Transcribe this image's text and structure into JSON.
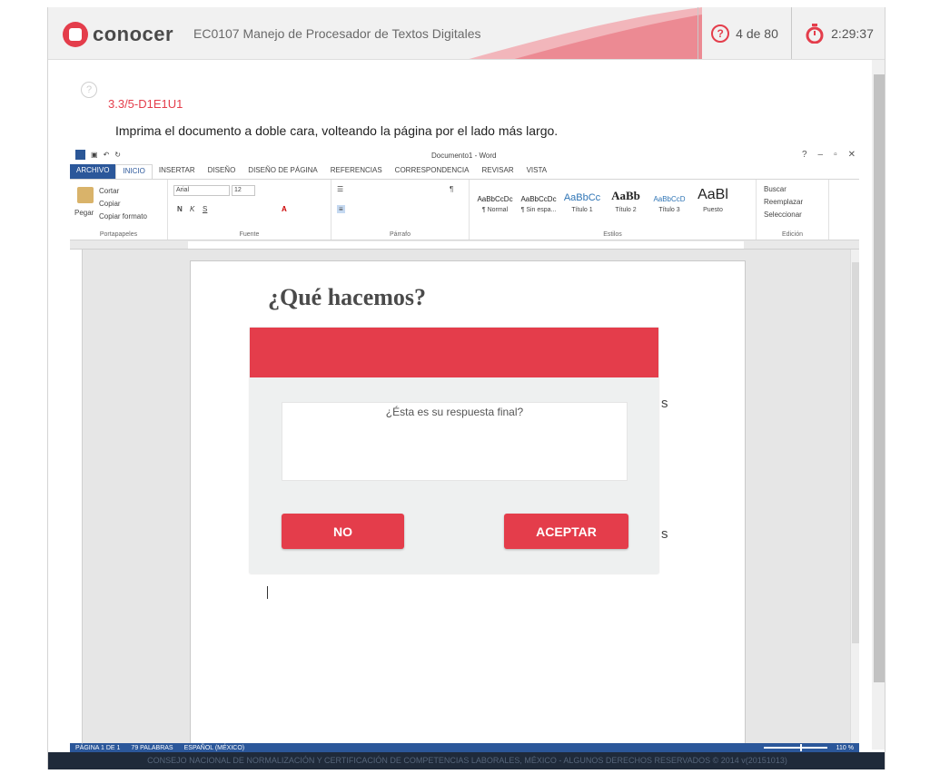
{
  "header": {
    "logo_text": "conocer",
    "exam_title": "EC0107 Manejo de Procesador de Textos Digitales",
    "counter": "4 de 80",
    "timer": "2:29:37"
  },
  "question": {
    "code": "3.3/5-D1E1U1",
    "text": "Imprima el documento a doble cara, volteando la página por el lado más largo."
  },
  "word": {
    "window_title": "Documento1 - Word",
    "tabs": [
      "ARCHIVO",
      "INICIO",
      "INSERTAR",
      "DISEÑO",
      "DISEÑO DE PÁGINA",
      "REFERENCIAS",
      "CORRESPONDENCIA",
      "REVISAR",
      "VISTA"
    ],
    "clipboard": {
      "paste": "Pegar",
      "cut": "Cortar",
      "copy": "Copiar",
      "format_painter": "Copiar formato",
      "label": "Portapapeles"
    },
    "font": {
      "name": "Arial",
      "size": "12",
      "label": "Fuente"
    },
    "paragraph_label": "Párrafo",
    "styles": {
      "label": "Estilos",
      "items": [
        {
          "sample": "AaBbCcDc",
          "name": "¶ Normal"
        },
        {
          "sample": "AaBbCcDc",
          "name": "¶ Sin espa..."
        },
        {
          "sample": "AaBbCc",
          "name": "Título 1"
        },
        {
          "sample": "AaBb",
          "name": "Título 2"
        },
        {
          "sample": "AaBbCcD",
          "name": "Título 3"
        },
        {
          "sample": "AaBl",
          "name": "Puesto"
        }
      ]
    },
    "editing": {
      "find": "Buscar",
      "replace": "Reemplazar",
      "select": "Seleccionar",
      "label": "Edición"
    },
    "document": {
      "title": "¿Qué hacemos?",
      "fragment_1": "s",
      "fragment_2": "s"
    },
    "status": {
      "page": "PÁGINA 1 DE 1",
      "words": "79 PALABRAS",
      "language": "ESPAÑOL (MÉXICO)",
      "zoom": "110 %"
    }
  },
  "footer": {
    "text": "CONSEJO NACIONAL DE NORMALIZACIÓN Y CERTIFICACIÓN DE COMPETENCIAS LABORALES, MÉXICO - ALGUNOS DERECHOS RESERVADOS © 2014 v(20151013)"
  },
  "modal": {
    "message": "¿Ésta es su respuesta final?",
    "no_label": "NO",
    "accept_label": "ACEPTAR"
  },
  "colors": {
    "accent": "#e43d4b",
    "word_blue": "#2b579a"
  }
}
